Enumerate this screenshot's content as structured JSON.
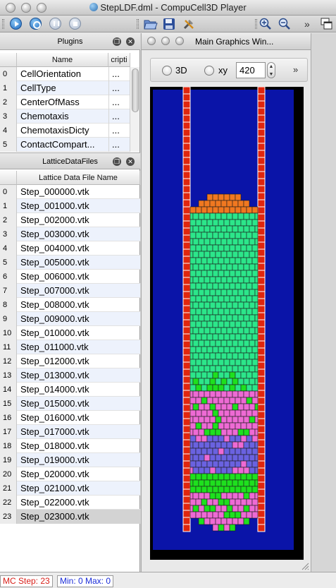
{
  "window": {
    "title": "StepLDF.dml - CompuCell3D Player"
  },
  "toolbar": {
    "buttons": [
      {
        "name": "run-button",
        "icon": "play-icon"
      },
      {
        "name": "step-button",
        "icon": "step-icon"
      },
      {
        "name": "pause-button",
        "icon": "pause-icon"
      },
      {
        "name": "stop-button",
        "icon": "stop-icon"
      },
      {
        "name": "open-button",
        "icon": "folder-open-icon"
      },
      {
        "name": "save-button",
        "icon": "floppy-disk-icon"
      },
      {
        "name": "tools-button",
        "icon": "tools-icon"
      },
      {
        "name": "zoom-in-button",
        "icon": "zoom-in-icon"
      },
      {
        "name": "zoom-out-button",
        "icon": "zoom-out-icon"
      },
      {
        "name": "overflow-button",
        "icon": "chevron-double-right-icon"
      },
      {
        "name": "windows-button",
        "icon": "tile-windows-icon"
      }
    ],
    "overflow_glyph": "»"
  },
  "plugins": {
    "title": "Plugins",
    "columns": [
      "Name",
      "cripti"
    ],
    "rows": [
      {
        "idx": "0",
        "name": "CellOrientation",
        "desc": "..."
      },
      {
        "idx": "1",
        "name": "CellType",
        "desc": "..."
      },
      {
        "idx": "2",
        "name": "CenterOfMass",
        "desc": "..."
      },
      {
        "idx": "3",
        "name": "Chemotaxis",
        "desc": "..."
      },
      {
        "idx": "4",
        "name": "ChemotaxisDicty",
        "desc": "..."
      },
      {
        "idx": "5",
        "name": "ContactCompart...",
        "desc": "..."
      }
    ]
  },
  "lattice": {
    "title": "LatticeDataFiles",
    "column": "Lattice Data File Name",
    "selected_index": 23,
    "rows": [
      {
        "idx": "0",
        "name": "Step_000000.vtk"
      },
      {
        "idx": "1",
        "name": "Step_001000.vtk"
      },
      {
        "idx": "2",
        "name": "Step_002000.vtk"
      },
      {
        "idx": "3",
        "name": "Step_003000.vtk"
      },
      {
        "idx": "4",
        "name": "Step_004000.vtk"
      },
      {
        "idx": "5",
        "name": "Step_005000.vtk"
      },
      {
        "idx": "6",
        "name": "Step_006000.vtk"
      },
      {
        "idx": "7",
        "name": "Step_007000.vtk"
      },
      {
        "idx": "8",
        "name": "Step_008000.vtk"
      },
      {
        "idx": "9",
        "name": "Step_009000.vtk"
      },
      {
        "idx": "10",
        "name": "Step_010000.vtk"
      },
      {
        "idx": "11",
        "name": "Step_011000.vtk"
      },
      {
        "idx": "12",
        "name": "Step_012000.vtk"
      },
      {
        "idx": "13",
        "name": "Step_013000.vtk"
      },
      {
        "idx": "14",
        "name": "Step_014000.vtk"
      },
      {
        "idx": "15",
        "name": "Step_015000.vtk"
      },
      {
        "idx": "16",
        "name": "Step_016000.vtk"
      },
      {
        "idx": "17",
        "name": "Step_017000.vtk"
      },
      {
        "idx": "18",
        "name": "Step_018000.vtk"
      },
      {
        "idx": "19",
        "name": "Step_019000.vtk"
      },
      {
        "idx": "20",
        "name": "Step_020000.vtk"
      },
      {
        "idx": "21",
        "name": "Step_021000.vtk"
      },
      {
        "idx": "22",
        "name": "Step_022000.vtk"
      },
      {
        "idx": "23",
        "name": "Step_023000.vtk"
      }
    ]
  },
  "graphics": {
    "title": "Main Graphics Win...",
    "radio_3d": "3D",
    "radio_xy": "xy",
    "slice_value": "420",
    "overflow_glyph": "»",
    "colors": {
      "medium": "#0a14a8",
      "wall": "#e0260e",
      "wall_grid": "#ffffff",
      "cell_top": "#f07820",
      "cell_main": "#2ce68a",
      "cell_green": "#1ee01e",
      "cell_pink": "#ee6ad4",
      "cell_blue": "#6a62e0",
      "cell_border": "#1c1c1c"
    }
  },
  "status": {
    "mc_step_label": "MC Step: 23",
    "min_max_label": "Min: 0 Max: 0",
    "mc_color": "#d8201a",
    "minmax_color": "#1a2cd8"
  }
}
